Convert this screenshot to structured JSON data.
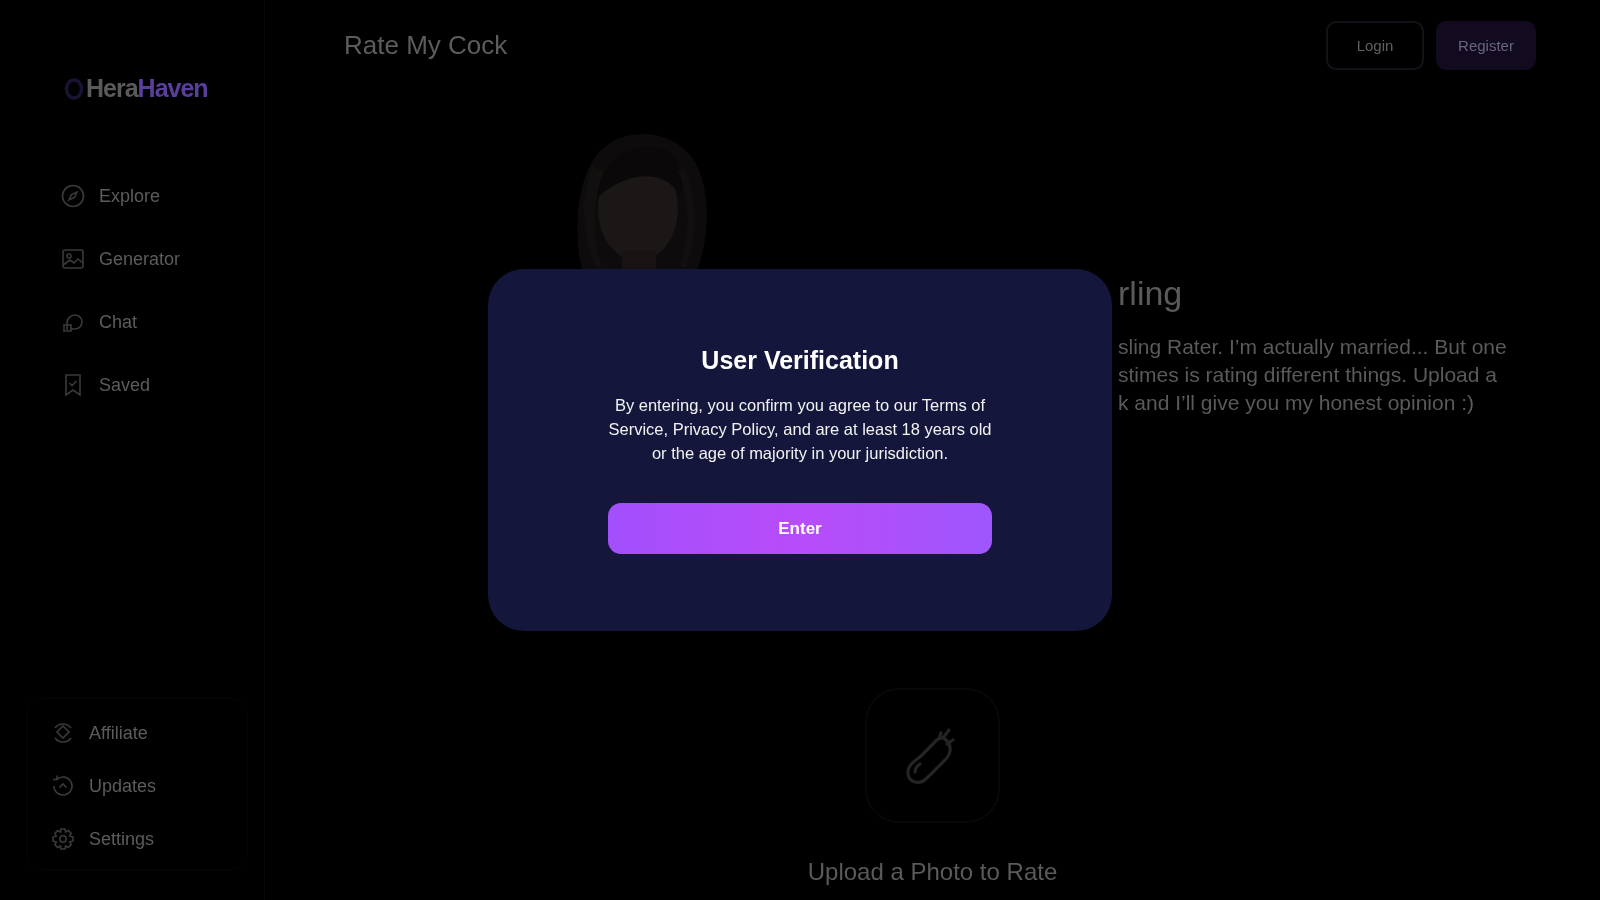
{
  "sidebar": {
    "logo": {
      "part_1": "Hera",
      "part_2": "Haven"
    },
    "nav": [
      {
        "label": "Explore"
      },
      {
        "label": "Generator"
      },
      {
        "label": "Chat"
      },
      {
        "label": "Saved"
      }
    ],
    "footer_nav": [
      {
        "label": "Affiliate"
      },
      {
        "label": "Updates"
      },
      {
        "label": "Settings"
      }
    ]
  },
  "header": {
    "title": "Rate My Cock",
    "buttons": [
      {
        "label": "Login",
        "kind": "outline"
      },
      {
        "label": "Register",
        "kind": "filled"
      }
    ]
  },
  "profile": {
    "name": "rling",
    "bio_lines": [
      "sling Rater. I’m actually married... But one",
      "stimes is rating different things. Upload a",
      "k and I’ll give you my honest opinion :)"
    ]
  },
  "upload": {
    "label": "Upload a Photo to Rate"
  },
  "modal": {
    "title": "User Verification",
    "text": "By entering, you confirm you agree to our Terms of Service, Privacy Policy, and are at least 18 years old or the age of majority in your jurisdiction.",
    "button": "Enter"
  }
}
